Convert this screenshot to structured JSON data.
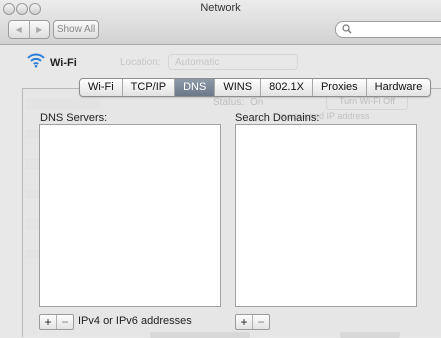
{
  "window": {
    "title": "Network"
  },
  "toolbar": {
    "back": "◀",
    "forward": "▶",
    "show_all": "Show All",
    "search_placeholder": ""
  },
  "service": {
    "name": "Wi-Fi"
  },
  "background_ghost": {
    "location_label": "Location:",
    "location_value": "Automatic",
    "status_label": "Status:",
    "status_value": "On",
    "turn_off_button": "Turn Wi-Fi Off",
    "assigned_text": "is assigned IP address"
  },
  "tabs": [
    {
      "label": "Wi-Fi",
      "active": false
    },
    {
      "label": "TCP/IP",
      "active": false
    },
    {
      "label": "DNS",
      "active": true
    },
    {
      "label": "WINS",
      "active": false
    },
    {
      "label": "802.1X",
      "active": false
    },
    {
      "label": "Proxies",
      "active": false
    },
    {
      "label": "Hardware",
      "active": false
    }
  ],
  "dns": {
    "servers_label": "DNS Servers:",
    "domains_label": "Search Domains:",
    "servers": [],
    "domains": [],
    "hint": "IPv4 or IPv6 addresses",
    "add": "+",
    "remove": "−"
  },
  "colors": {
    "active_tab": "#7b8898",
    "wifi_blue": "#2f7fd8"
  }
}
